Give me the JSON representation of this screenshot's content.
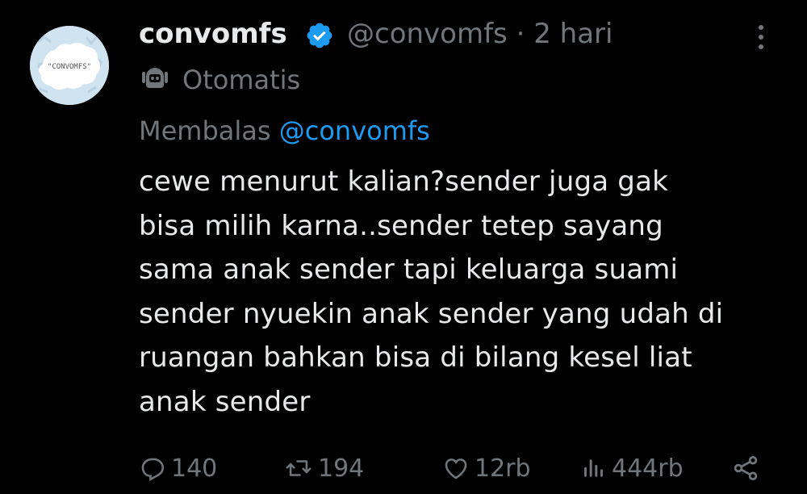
{
  "author": {
    "display_name": "convomfs",
    "handle": "@convomfs",
    "separator": "·",
    "time": "2 hari",
    "avatar_text": "\"CONVOMFS\"",
    "verified_color": "#1d9bf0"
  },
  "automated": {
    "label": "Otomatis",
    "icon": "bot-icon"
  },
  "reply": {
    "prefix": "Membalas",
    "to_handle": "@convomfs"
  },
  "body": {
    "lines": [
      "cewe menurut kalian?sender juga gak",
      "bisa milih karna..sender tetep sayang",
      "sama anak sender tapi keluarga suami",
      "sender nyuekin anak sender yang udah di",
      "ruangan bahkan bisa di bilang kesel liat",
      "anak sender"
    ]
  },
  "actions": {
    "replies": "140",
    "reposts": "194",
    "likes": "12rb",
    "views": "444rb"
  },
  "colors": {
    "background": "#000000",
    "text": "#e7e9ea",
    "muted": "#71767b",
    "accent": "#1d9bf0"
  }
}
